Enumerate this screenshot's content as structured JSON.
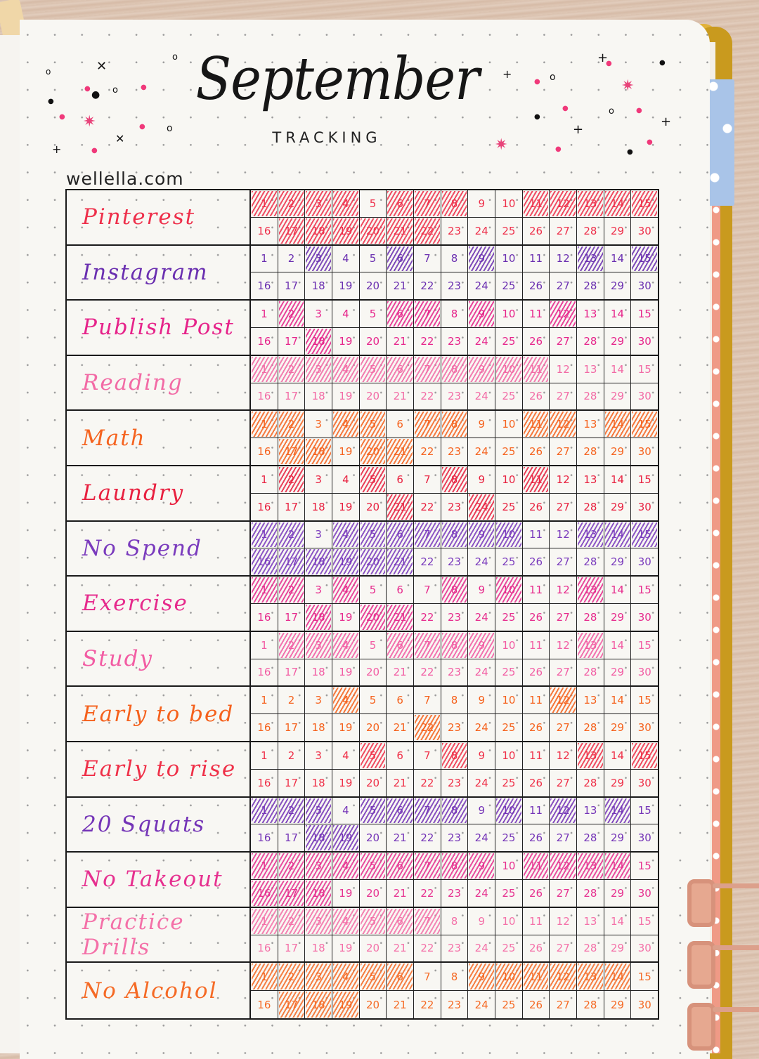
{
  "header": {
    "title": "September",
    "subtitle": "TRACKING",
    "site": "wellella.com"
  },
  "days_per_month": 30,
  "habits": [
    {
      "name": "Pinterest",
      "color": "#ee2f4a",
      "done": [
        1,
        2,
        3,
        4,
        6,
        7,
        8,
        11,
        12,
        13,
        14,
        15,
        17,
        18,
        19,
        20,
        21,
        22
      ]
    },
    {
      "name": "Instagram",
      "color": "#6a2fb0",
      "done": [
        3,
        6,
        9,
        13,
        15
      ]
    },
    {
      "name": "Publish Post",
      "color": "#e6238a",
      "done": [
        2,
        6,
        7,
        9,
        12,
        18
      ]
    },
    {
      "name": "Reading",
      "color": "#f26aa5",
      "done": [
        1,
        2,
        3,
        4,
        5,
        6,
        7,
        8,
        9,
        10,
        11
      ]
    },
    {
      "name": "Math",
      "color": "#f5631f",
      "done": [
        1,
        2,
        4,
        5,
        7,
        8,
        11,
        12,
        14,
        15,
        17,
        18,
        20,
        21
      ]
    },
    {
      "name": "Laundry",
      "color": "#e8203f",
      "done": [
        2,
        5,
        8,
        11,
        21,
        24
      ]
    },
    {
      "name": "No Spend",
      "color": "#7a3bbd",
      "done": [
        1,
        2,
        4,
        5,
        6,
        7,
        8,
        9,
        10,
        13,
        14,
        15,
        16,
        17,
        18,
        19,
        20,
        21
      ]
    },
    {
      "name": "Exercise",
      "color": "#e62a8c",
      "done": [
        1,
        2,
        4,
        8,
        10,
        13,
        18,
        20,
        21
      ]
    },
    {
      "name": "Study",
      "color": "#f25ca3",
      "done": [
        2,
        3,
        4,
        6,
        7,
        8,
        9,
        13
      ]
    },
    {
      "name": "Early to bed",
      "color": "#f5611c",
      "done": [
        4,
        12,
        22
      ]
    },
    {
      "name": "Early to rise",
      "color": "#ef3048",
      "done": [
        5,
        8,
        13,
        15
      ]
    },
    {
      "name": "20 Squats",
      "color": "#7434b7",
      "done": [
        1,
        2,
        3,
        5,
        6,
        7,
        8,
        10,
        12,
        14,
        18,
        19
      ]
    },
    {
      "name": "No Takeout",
      "color": "#e6308f",
      "done": [
        1,
        2,
        3,
        4,
        5,
        6,
        7,
        8,
        9,
        11,
        12,
        13,
        14,
        16,
        17,
        18
      ]
    },
    {
      "name": "Practice Drills",
      "color": "#f470a8",
      "done": [
        1,
        2,
        3,
        4,
        5,
        6,
        7
      ]
    },
    {
      "name": "No Alcohol",
      "color": "#f56a25",
      "done": [
        1,
        2,
        3,
        4,
        5,
        6,
        9,
        10,
        11,
        12,
        13,
        14,
        17,
        18,
        19
      ]
    }
  ]
}
